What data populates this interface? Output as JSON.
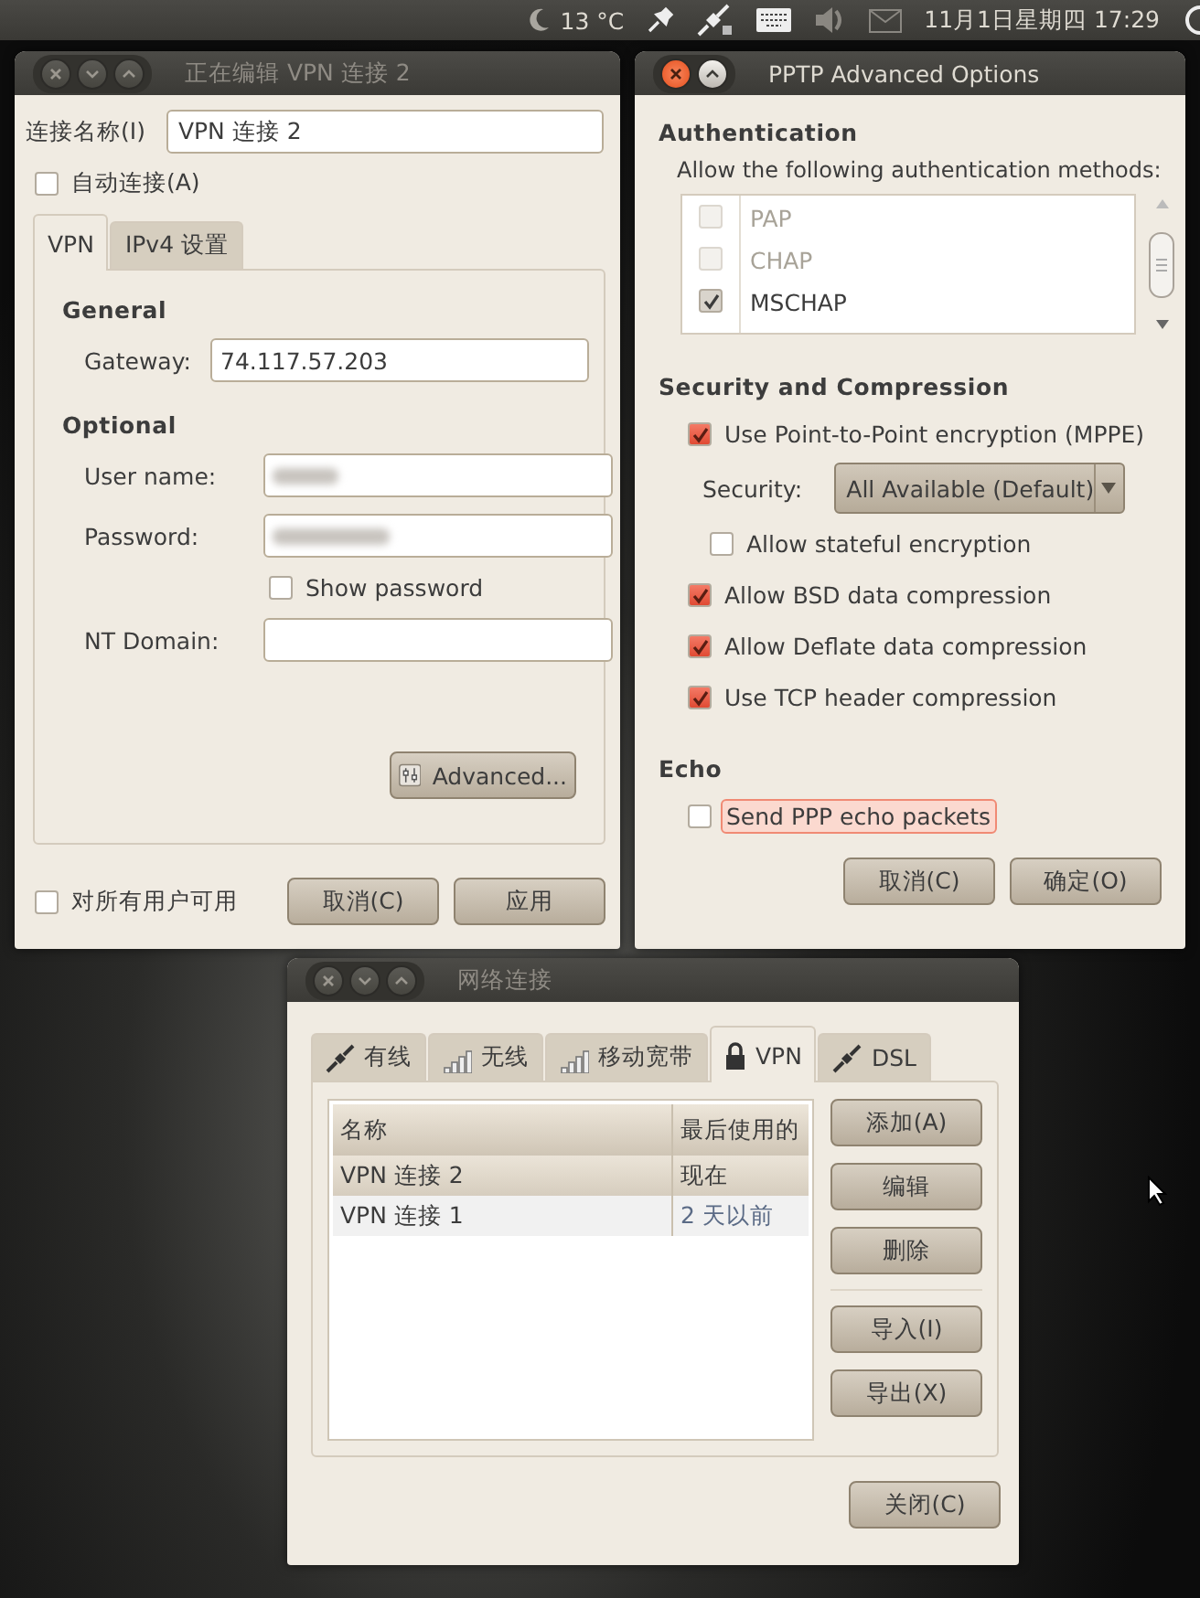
{
  "top_panel": {
    "weather": "13 °C",
    "clock": "11月1日星期四 17:29"
  },
  "editor_window": {
    "title": "正在编辑 VPN 连接 2",
    "name_label": "连接名称(I)",
    "name_value": "VPN 连接 2",
    "auto_connect": {
      "label": "自动连接(A)",
      "checked": false
    },
    "tabs": [
      {
        "label": "VPN",
        "selected": true
      },
      {
        "label": "IPv4 设置",
        "selected": false
      }
    ],
    "general_heading": "General",
    "gateway_label": "Gateway:",
    "gateway_value": "74.117.57.203",
    "optional_heading": "Optional",
    "username_label": "User name:",
    "password_label": "Password:",
    "show_password": {
      "label": "Show password",
      "checked": false
    },
    "nt_domain_label": "NT Domain:",
    "advanced_button": "Advanced...",
    "all_users": {
      "label": "对所有用户可用",
      "checked": false
    },
    "buttons": [
      "取消(C)",
      "应用"
    ]
  },
  "pptp_window": {
    "title": "PPTP Advanced Options",
    "auth_heading": "Authentication",
    "auth_hint": "Allow the following authentication methods:",
    "methods": [
      {
        "label": "PAP",
        "checked": false,
        "disabled": true
      },
      {
        "label": "CHAP",
        "checked": false,
        "disabled": true
      },
      {
        "label": "MSCHAP",
        "checked": true,
        "disabled": false
      }
    ],
    "security_heading": "Security and Compression",
    "options": [
      {
        "kind": "checkbox",
        "label": "Use Point-to-Point encryption (MPPE)",
        "checked": true
      },
      {
        "kind": "select",
        "label": "Security:",
        "value": "All Available (Default)"
      },
      {
        "kind": "sub-checkbox",
        "label": "Allow stateful encryption",
        "checked": false
      },
      {
        "kind": "checkbox",
        "label": "Allow BSD data compression",
        "checked": true
      },
      {
        "kind": "checkbox",
        "label": "Allow Deflate data compression",
        "checked": true
      },
      {
        "kind": "checkbox",
        "label": "Use TCP header compression",
        "checked": true
      }
    ],
    "echo_heading": "Echo",
    "echo": {
      "label": "Send PPP echo packets",
      "checked": false,
      "focused": true
    },
    "buttons": [
      "取消(C)",
      "确定(O)"
    ]
  },
  "network_window": {
    "title": "网络连接",
    "tabs": [
      {
        "kind": "wired",
        "label": "有线",
        "selected": false
      },
      {
        "kind": "wireless",
        "label": "无线",
        "selected": false
      },
      {
        "kind": "mobile",
        "label": "移动宽带",
        "selected": false
      },
      {
        "kind": "vpn",
        "label": "VPN",
        "selected": true
      },
      {
        "kind": "dsl",
        "label": "DSL",
        "selected": false
      }
    ],
    "columns": [
      "名称",
      "最后使用的"
    ],
    "rows": [
      {
        "name": "VPN 连接 2",
        "last_used": "现在",
        "selected": true
      },
      {
        "name": "VPN 连接 1",
        "last_used": "2 天以前",
        "selected": false
      }
    ],
    "buttons": [
      "添加(A)",
      "编辑",
      "删除"
    ],
    "io_buttons": [
      "导入(I)",
      "导出(X)"
    ],
    "close_button": "关闭(C)"
  }
}
